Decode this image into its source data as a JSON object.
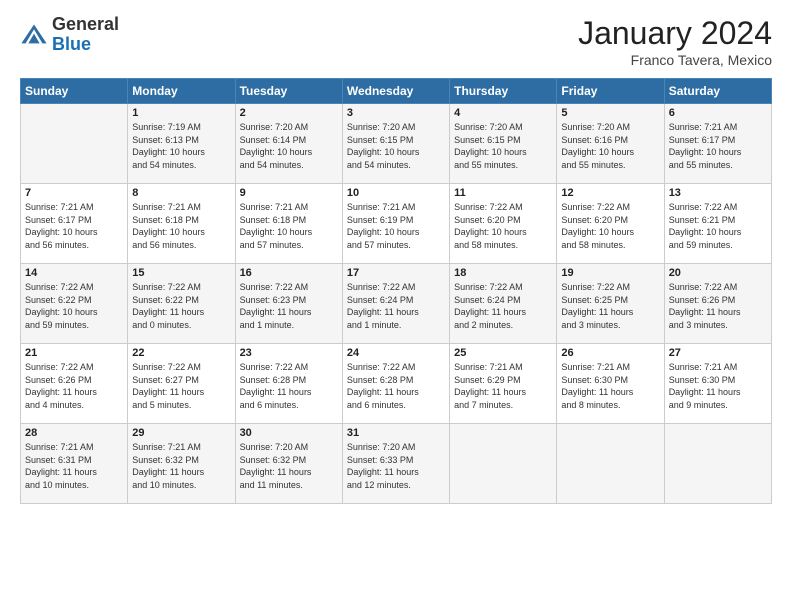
{
  "header": {
    "logo_general": "General",
    "logo_blue": "Blue",
    "month_title": "January 2024",
    "location": "Franco Tavera, Mexico"
  },
  "days_of_week": [
    "Sunday",
    "Monday",
    "Tuesday",
    "Wednesday",
    "Thursday",
    "Friday",
    "Saturday"
  ],
  "weeks": [
    [
      {
        "day": "",
        "info": ""
      },
      {
        "day": "1",
        "info": "Sunrise: 7:19 AM\nSunset: 6:13 PM\nDaylight: 10 hours\nand 54 minutes."
      },
      {
        "day": "2",
        "info": "Sunrise: 7:20 AM\nSunset: 6:14 PM\nDaylight: 10 hours\nand 54 minutes."
      },
      {
        "day": "3",
        "info": "Sunrise: 7:20 AM\nSunset: 6:15 PM\nDaylight: 10 hours\nand 54 minutes."
      },
      {
        "day": "4",
        "info": "Sunrise: 7:20 AM\nSunset: 6:15 PM\nDaylight: 10 hours\nand 55 minutes."
      },
      {
        "day": "5",
        "info": "Sunrise: 7:20 AM\nSunset: 6:16 PM\nDaylight: 10 hours\nand 55 minutes."
      },
      {
        "day": "6",
        "info": "Sunrise: 7:21 AM\nSunset: 6:17 PM\nDaylight: 10 hours\nand 55 minutes."
      }
    ],
    [
      {
        "day": "7",
        "info": "Sunrise: 7:21 AM\nSunset: 6:17 PM\nDaylight: 10 hours\nand 56 minutes."
      },
      {
        "day": "8",
        "info": "Sunrise: 7:21 AM\nSunset: 6:18 PM\nDaylight: 10 hours\nand 56 minutes."
      },
      {
        "day": "9",
        "info": "Sunrise: 7:21 AM\nSunset: 6:18 PM\nDaylight: 10 hours\nand 57 minutes."
      },
      {
        "day": "10",
        "info": "Sunrise: 7:21 AM\nSunset: 6:19 PM\nDaylight: 10 hours\nand 57 minutes."
      },
      {
        "day": "11",
        "info": "Sunrise: 7:22 AM\nSunset: 6:20 PM\nDaylight: 10 hours\nand 58 minutes."
      },
      {
        "day": "12",
        "info": "Sunrise: 7:22 AM\nSunset: 6:20 PM\nDaylight: 10 hours\nand 58 minutes."
      },
      {
        "day": "13",
        "info": "Sunrise: 7:22 AM\nSunset: 6:21 PM\nDaylight: 10 hours\nand 59 minutes."
      }
    ],
    [
      {
        "day": "14",
        "info": "Sunrise: 7:22 AM\nSunset: 6:22 PM\nDaylight: 10 hours\nand 59 minutes."
      },
      {
        "day": "15",
        "info": "Sunrise: 7:22 AM\nSunset: 6:22 PM\nDaylight: 11 hours\nand 0 minutes."
      },
      {
        "day": "16",
        "info": "Sunrise: 7:22 AM\nSunset: 6:23 PM\nDaylight: 11 hours\nand 1 minute."
      },
      {
        "day": "17",
        "info": "Sunrise: 7:22 AM\nSunset: 6:24 PM\nDaylight: 11 hours\nand 1 minute."
      },
      {
        "day": "18",
        "info": "Sunrise: 7:22 AM\nSunset: 6:24 PM\nDaylight: 11 hours\nand 2 minutes."
      },
      {
        "day": "19",
        "info": "Sunrise: 7:22 AM\nSunset: 6:25 PM\nDaylight: 11 hours\nand 3 minutes."
      },
      {
        "day": "20",
        "info": "Sunrise: 7:22 AM\nSunset: 6:26 PM\nDaylight: 11 hours\nand 3 minutes."
      }
    ],
    [
      {
        "day": "21",
        "info": "Sunrise: 7:22 AM\nSunset: 6:26 PM\nDaylight: 11 hours\nand 4 minutes."
      },
      {
        "day": "22",
        "info": "Sunrise: 7:22 AM\nSunset: 6:27 PM\nDaylight: 11 hours\nand 5 minutes."
      },
      {
        "day": "23",
        "info": "Sunrise: 7:22 AM\nSunset: 6:28 PM\nDaylight: 11 hours\nand 6 minutes."
      },
      {
        "day": "24",
        "info": "Sunrise: 7:22 AM\nSunset: 6:28 PM\nDaylight: 11 hours\nand 6 minutes."
      },
      {
        "day": "25",
        "info": "Sunrise: 7:21 AM\nSunset: 6:29 PM\nDaylight: 11 hours\nand 7 minutes."
      },
      {
        "day": "26",
        "info": "Sunrise: 7:21 AM\nSunset: 6:30 PM\nDaylight: 11 hours\nand 8 minutes."
      },
      {
        "day": "27",
        "info": "Sunrise: 7:21 AM\nSunset: 6:30 PM\nDaylight: 11 hours\nand 9 minutes."
      }
    ],
    [
      {
        "day": "28",
        "info": "Sunrise: 7:21 AM\nSunset: 6:31 PM\nDaylight: 11 hours\nand 10 minutes."
      },
      {
        "day": "29",
        "info": "Sunrise: 7:21 AM\nSunset: 6:32 PM\nDaylight: 11 hours\nand 10 minutes."
      },
      {
        "day": "30",
        "info": "Sunrise: 7:20 AM\nSunset: 6:32 PM\nDaylight: 11 hours\nand 11 minutes."
      },
      {
        "day": "31",
        "info": "Sunrise: 7:20 AM\nSunset: 6:33 PM\nDaylight: 11 hours\nand 12 minutes."
      },
      {
        "day": "",
        "info": ""
      },
      {
        "day": "",
        "info": ""
      },
      {
        "day": "",
        "info": ""
      }
    ]
  ]
}
